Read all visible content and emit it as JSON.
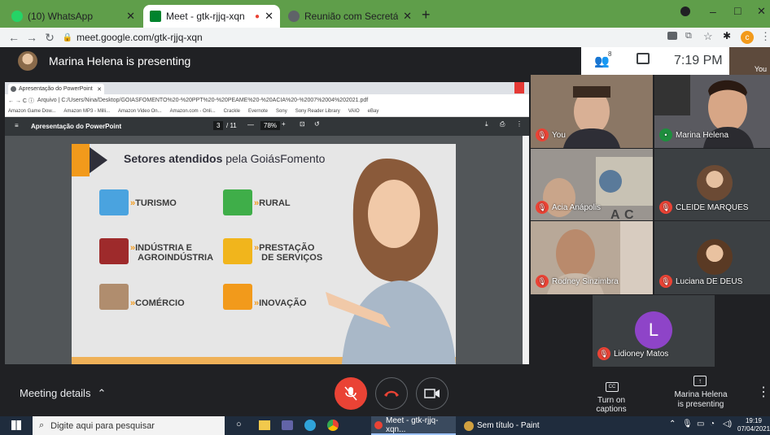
{
  "browser": {
    "tabs": [
      {
        "label": "(10) WhatsApp",
        "icon": "whatsapp-icon"
      },
      {
        "label": "Meet - gtk-rjjq-xqn",
        "icon": "meet-icon"
      },
      {
        "label": "Reunião com Secretário da Retor",
        "icon": "chrome-page-icon"
      }
    ],
    "new_tab": "+",
    "url": "meet.google.com/gtk-rjjq-xqn",
    "window_controls": [
      "–",
      "□",
      "✕"
    ],
    "profile_initial": "c"
  },
  "meet_header": {
    "presenter_text": "Marina Helena is presenting",
    "participants_count": "8",
    "time": "7:19 PM",
    "self_label": "You"
  },
  "presentation": {
    "tab_label": "Apresentação do PowerPoint",
    "address": "Arquivo  |  C:/Users/Nina/Desktop/GOIASFOMENTO%20-%20PPT%20-%20PEAME%20-%20ACIA%20-%2007%2004%202021.pdf",
    "bookmarks": [
      "Amazon Game Dow...",
      "Amazon MP3 - Milli...",
      "Amazon Video On...",
      "Amazon.com - Onli...",
      "Crackle",
      "Evernote",
      "Sony",
      "Sony Reader Library",
      "VAIO",
      "eBay"
    ],
    "pdf_title": "Apresentação do PowerPoint",
    "page": "3",
    "page_total": "/ 11",
    "zoom": "78%",
    "slide_title_bold": "Setores atendidos",
    "slide_title_rest": " pela GoiásFomento",
    "sectors": [
      {
        "line1": "TURISMO",
        "line2": "",
        "color": "#4aa3df"
      },
      {
        "line1": "RURAL",
        "line2": "",
        "color": "#3fae49"
      },
      {
        "line1": "INDÚSTRIA E",
        "line2": "AGROINDÚSTRIA",
        "color": "#9e2a2b"
      },
      {
        "line1": "PRESTAÇÃO",
        "line2": "DE SERVIÇOS",
        "color": "#f1b51c"
      },
      {
        "line1": "COMÉRCIO",
        "line2": "",
        "color": "#b08d6e"
      },
      {
        "line1": "INOVAÇÃO",
        "line2": "",
        "color": "#f29a1b"
      }
    ]
  },
  "participants": [
    {
      "name": "You",
      "muted": true
    },
    {
      "name": "Marina Helena",
      "muted": false
    },
    {
      "name": "Acia Anápolis",
      "muted": true
    },
    {
      "name": "CLEIDE MARQUES",
      "muted": true
    },
    {
      "name": "Rodney Sinzimbra",
      "muted": true
    },
    {
      "name": "Luciana DE DEUS",
      "muted": true
    },
    {
      "name": "Lidioney Matos",
      "muted": true,
      "initial": "L"
    }
  ],
  "controls": {
    "meeting_details": "Meeting details",
    "captions_label": "Turn on captions",
    "captions_icon": "CC",
    "presenting_line1": "Marina Helena",
    "presenting_line2": "is presenting"
  },
  "taskbar": {
    "search_placeholder": "Digite aqui para pesquisar",
    "apps": [
      {
        "label": "Meet - gtk-rjjq-xqn..."
      },
      {
        "label": "Sem título - Paint"
      }
    ],
    "time": "19:19",
    "date": "07/04/2021"
  }
}
